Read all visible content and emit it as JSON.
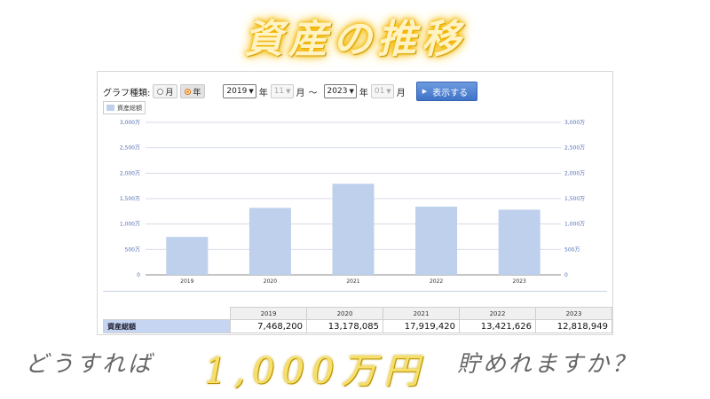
{
  "title": "資産の推移",
  "toolbar": {
    "graph_type_label": "グラフ種類:",
    "option_month": "月",
    "option_year": "年",
    "start_year": "2019",
    "start_year_unit": "年",
    "start_month": "11",
    "start_month_unit": "月",
    "range_sep": "～",
    "end_year": "2023",
    "end_year_unit": "年",
    "end_month": "01",
    "end_month_unit": "月",
    "show_button": "表示する"
  },
  "legend_label": "資産総額",
  "chart_data": {
    "type": "bar",
    "categories": [
      "2019",
      "2020",
      "2021",
      "2022",
      "2023"
    ],
    "series": [
      {
        "name": "資産総額",
        "values": [
          7468200,
          13178085,
          17919420,
          13421626,
          12818949
        ]
      }
    ],
    "ylim": [
      0,
      30000000
    ],
    "y_ticks": [
      "0",
      "500万",
      "1,000万",
      "1,500万",
      "2,000万",
      "2,500万",
      "3,000万"
    ],
    "y_tick_values": [
      0,
      5000000,
      10000000,
      15000000,
      20000000,
      25000000,
      30000000
    ],
    "bar_color": "#bfd0ec",
    "grid": true
  },
  "table": {
    "headers": [
      "2019",
      "2020",
      "2021",
      "2022",
      "2023"
    ],
    "row_label": "資産総額",
    "values": [
      "7,468,200",
      "13,178,085",
      "17,919,420",
      "13,421,626",
      "12,818,949"
    ]
  },
  "caption": {
    "left": "どうすれば",
    "middle": "1,000万円",
    "right": "貯めれますか？"
  }
}
